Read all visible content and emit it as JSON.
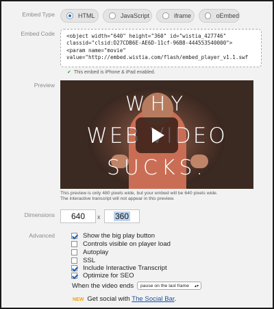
{
  "labels": {
    "embed_type": "Embed Type",
    "embed_code": "Embed Code",
    "preview": "Preview",
    "dimensions": "Dimensions",
    "advanced": "Advanced"
  },
  "embed_types": [
    {
      "label": "HTML",
      "selected": true
    },
    {
      "label": "JavaScript",
      "selected": false
    },
    {
      "label": "iframe",
      "selected": false
    },
    {
      "label": "oEmbed",
      "selected": false
    }
  ],
  "embed_code": {
    "lines": [
      "<object width=\"640\" height=\"360\" id=\"wistia_427746\"",
      "classid=\"clsid:D27CDB6E-AE6D-11cf-96B8-444553540000\">",
      "<param name=\"movie\"",
      "value=\"http://embed.wistia.com/flash/embed_player_v1.1.swf"
    ]
  },
  "embed_note": "This embed is iPhone & iPad enabled.",
  "video": {
    "title_line1": "WHY",
    "title_line2": "WEB VIDEO",
    "title_line3": "SUCKS."
  },
  "preview_note": {
    "line1": "This preview is only 480 pixels wide, but your embed will be 640 pixels wide.",
    "line2": "The interactive transcript will not appear in this preview."
  },
  "dimensions": {
    "width": "640",
    "separator": "x",
    "height": "360"
  },
  "advanced_options": [
    {
      "label": "Show the big play button",
      "checked": true
    },
    {
      "label": "Controls visible on player load",
      "checked": false
    },
    {
      "label": "Autoplay",
      "checked": false
    },
    {
      "label": "SSL",
      "checked": false
    },
    {
      "label": "Include Interactive Transcript",
      "checked": true
    },
    {
      "label": "Optimize for SEO",
      "checked": true
    }
  ],
  "video_ends": {
    "label": "When the video ends",
    "selected": "pause on the last frame"
  },
  "social": {
    "badge": "NEW",
    "text": "Get social with",
    "link": "The Social Bar",
    "suffix": "."
  },
  "colors": {
    "accent": "#1a6fd1",
    "new_badge": "#f0a400",
    "link": "#1f4f9e",
    "check_ok": "#2e9c3a"
  }
}
